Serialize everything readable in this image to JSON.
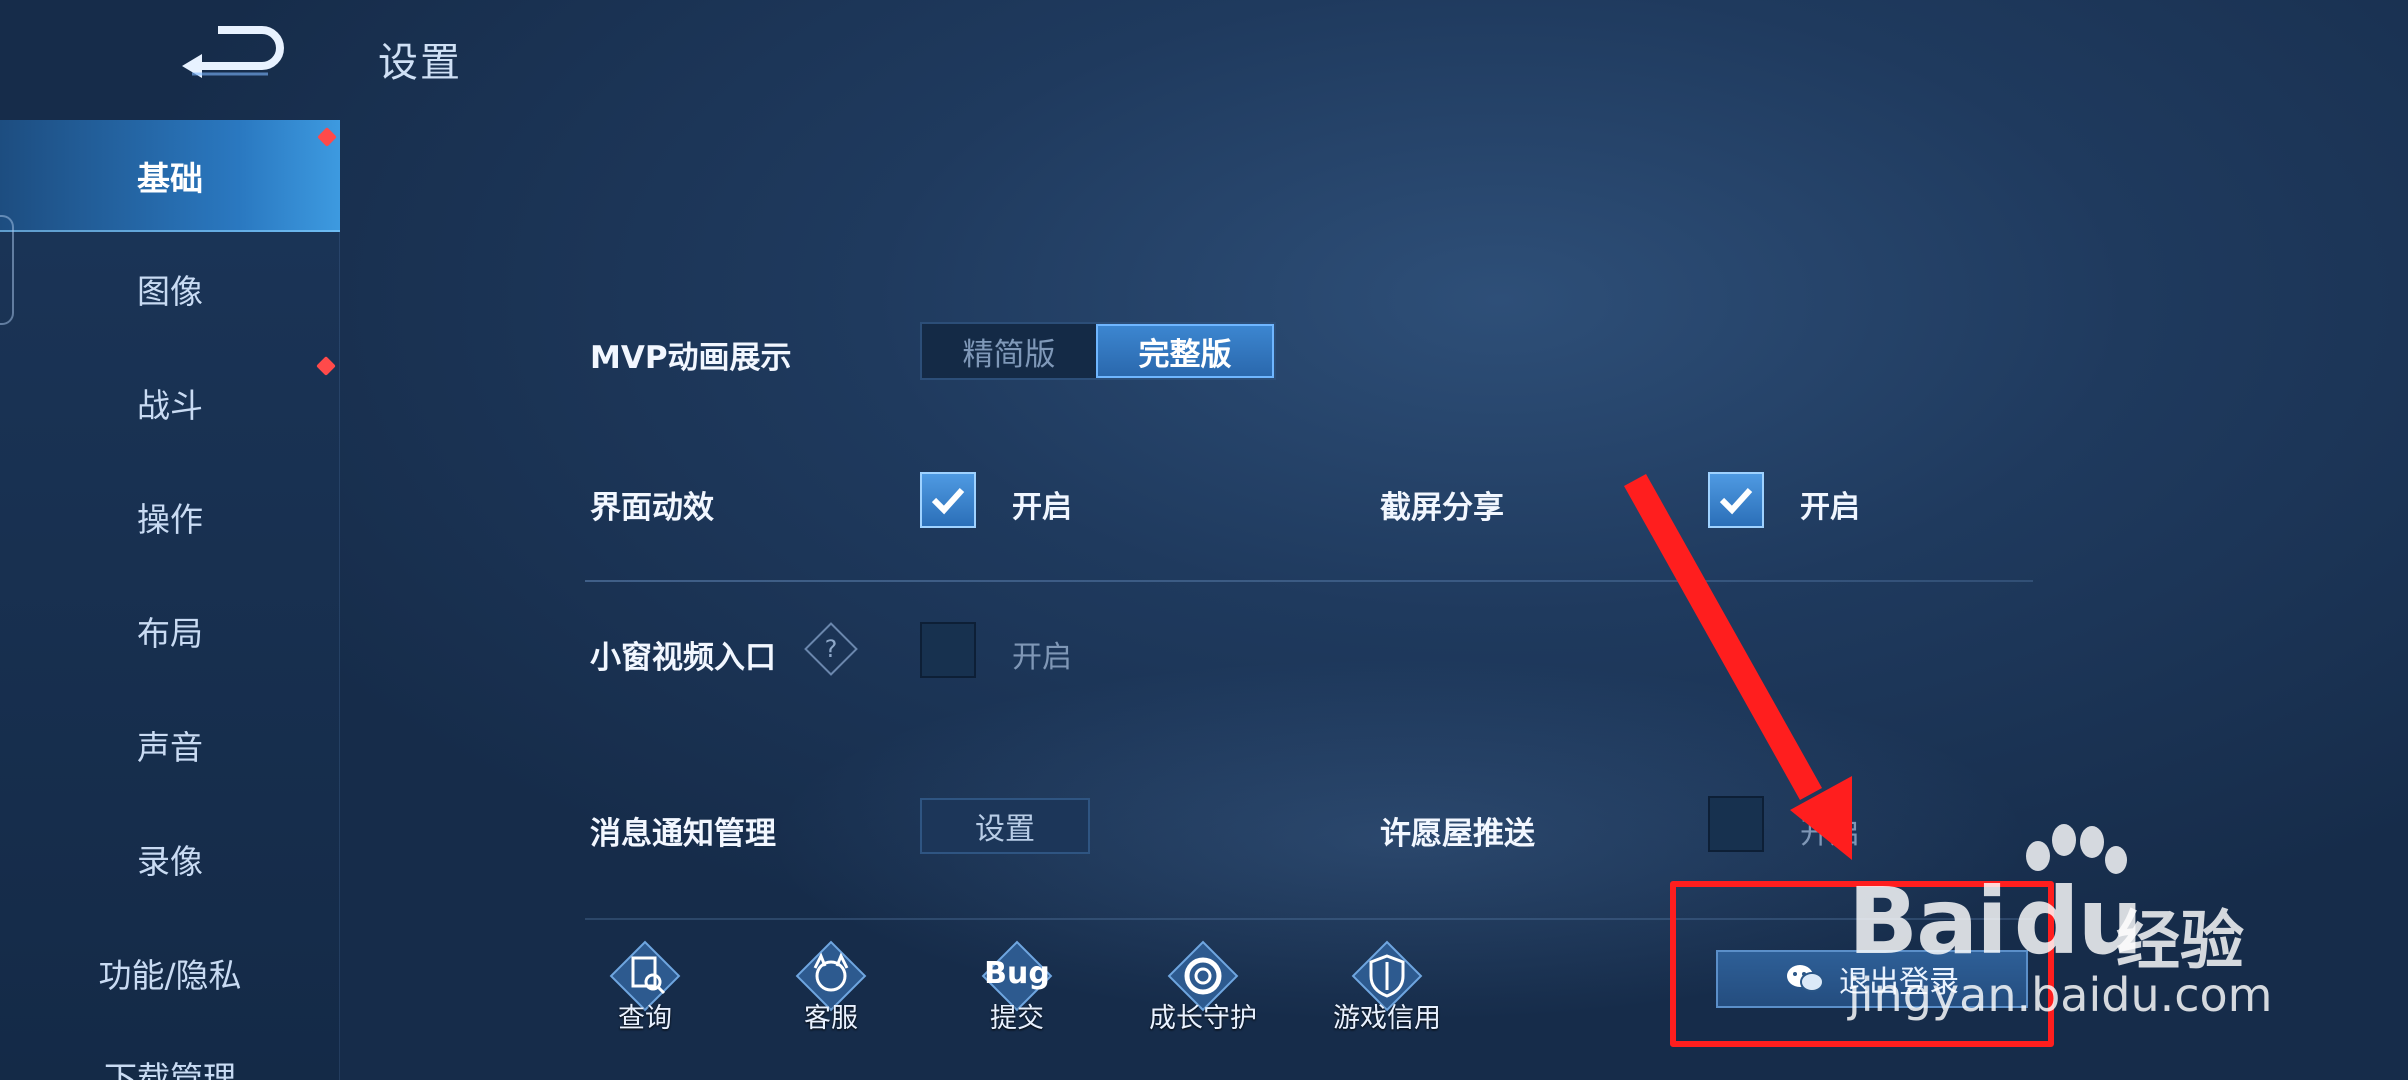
{
  "header": {
    "title": "设置"
  },
  "sidebar": {
    "items": [
      {
        "label": "基础",
        "active": true,
        "badge": true
      },
      {
        "label": "图像",
        "active": false,
        "badge": false
      },
      {
        "label": "战斗",
        "active": false,
        "badge": true
      },
      {
        "label": "操作",
        "active": false,
        "badge": false
      },
      {
        "label": "布局",
        "active": false,
        "badge": false
      },
      {
        "label": "声音",
        "active": false,
        "badge": false
      },
      {
        "label": "录像",
        "active": false,
        "badge": false
      },
      {
        "label": "功能/隐私",
        "active": false,
        "badge": false
      },
      {
        "label": "下载管理",
        "active": false,
        "badge": false
      }
    ]
  },
  "settings": {
    "mvp": {
      "label": "MVP动画展示",
      "options": [
        "精简版",
        "完整版"
      ],
      "selected": "完整版"
    },
    "ui_effects": {
      "label": "界面动效",
      "option": "开启",
      "checked": true
    },
    "screenshot_share": {
      "label": "截屏分享",
      "option": "开启",
      "checked": true
    },
    "mini_window": {
      "label": "小窗视频入口",
      "option": "开启",
      "checked": false,
      "help": "?"
    },
    "notifications": {
      "label": "消息通知管理",
      "button": "设置"
    },
    "wish_house": {
      "label": "许愿屋推送",
      "option": "开启",
      "checked": false
    }
  },
  "bottom_bar": {
    "items": [
      {
        "label": "查询",
        "icon": "search-doc-icon"
      },
      {
        "label": "客服",
        "icon": "service-icon",
        "caption": ""
      },
      {
        "label": "提交",
        "icon": "bug-icon",
        "caption": "Bug"
      },
      {
        "label": "成长守护",
        "icon": "growth-guard-icon"
      },
      {
        "label": "游戏信用",
        "icon": "credit-shield-icon"
      }
    ],
    "logout": {
      "label": "退出登录",
      "icon": "wechat-icon"
    }
  },
  "watermark": {
    "brand": "Bai",
    "brand_tail": "du",
    "cn": "经验",
    "url": "jingyan.baidu.com"
  },
  "colors": {
    "accent": "#3c86d0",
    "annotation": "#ff1e1e",
    "badge": "#ff4a4a"
  }
}
